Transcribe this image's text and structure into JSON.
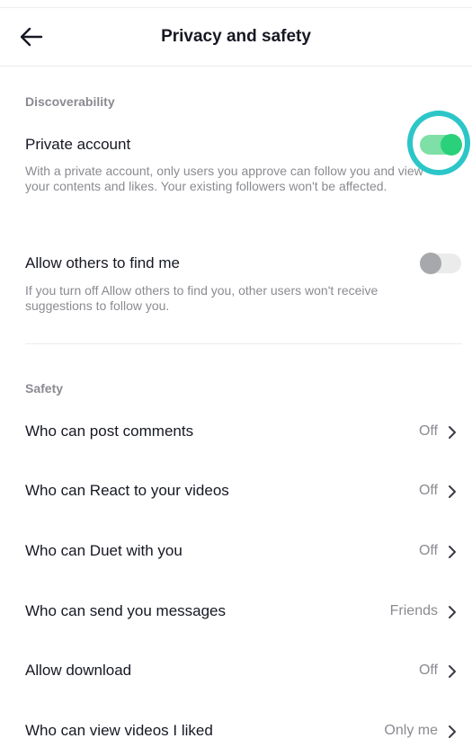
{
  "header": {
    "title": "Privacy and safety",
    "back_icon": "arrow-left-icon"
  },
  "discoverability": {
    "section_label": "Discoverability",
    "private_account": {
      "title": "Private account",
      "description": "With a private account, only users you approve can follow you and view your contents and likes. Your existing followers won't be affected.",
      "enabled": true
    },
    "find_me": {
      "title": "Allow others to find me",
      "description": "If you turn off Allow others to find you, other users won't receive suggestions to follow you.",
      "enabled": false
    }
  },
  "safety": {
    "section_label": "Safety",
    "rows": [
      {
        "label": "Who can post comments",
        "value": "Off"
      },
      {
        "label": "Who can React to your videos",
        "value": "Off"
      },
      {
        "label": "Who can Duet with you",
        "value": "Off"
      },
      {
        "label": "Who can send you messages",
        "value": "Friends"
      },
      {
        "label": "Allow download",
        "value": "Off"
      },
      {
        "label": "Who can view videos I liked",
        "value": "Only me"
      }
    ]
  },
  "colors": {
    "toggle_on_track": "#7ee0a6",
    "toggle_on_knob": "#2bd17a",
    "highlight_ring": "#2cc6c8",
    "secondary_text": "#8a8b91"
  }
}
